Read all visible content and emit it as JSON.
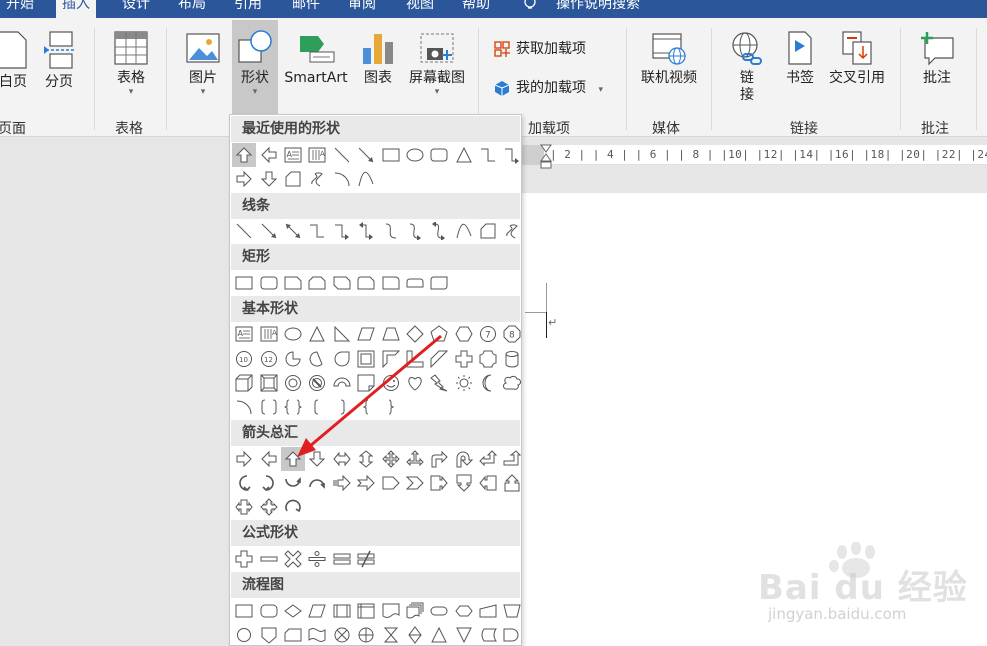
{
  "tabs": [
    "开始",
    "插入",
    "设计",
    "布局",
    "引用",
    "邮件",
    "审阅",
    "视图",
    "帮助",
    "操作说明搜索"
  ],
  "ribbon": {
    "blank_page": "白页",
    "page_break": "分页",
    "group_pages": "页面",
    "table": "表格",
    "group_tables": "表格",
    "picture": "图片",
    "shapes": "形状",
    "smartart": "SmartArt",
    "chart": "图表",
    "screenshot": "屏幕截图",
    "get_addins": "获取加载项",
    "my_addins": "我的加载项",
    "group_addins": "加载项",
    "online_video": "联机视频",
    "group_media": "媒体",
    "link_1": "链",
    "link_2": "接",
    "bookmark": "书签",
    "cross_ref": "交叉引用",
    "group_links": "链接",
    "comment": "批注",
    "group_comments": "批注"
  },
  "ruler": {
    "ticks": "| 2 |   | 4 |   | 6 |   | 8 |   |10|   |12|   |14|   |16|   |18|   |20|   |22|   |24|"
  },
  "menu": {
    "recent": "最近使用的形状",
    "lines": "线条",
    "rectangles": "矩形",
    "basic": "基本形状",
    "block_arrows": "箭头总汇",
    "equation": "公式形状",
    "flowchart": "流程图"
  },
  "watermark": {
    "text": "Bai du 经验",
    "sub": "jingyan.baidu.com"
  },
  "colors": {
    "tab_blue": "#2b579a",
    "annotation_red": "#e02020"
  }
}
